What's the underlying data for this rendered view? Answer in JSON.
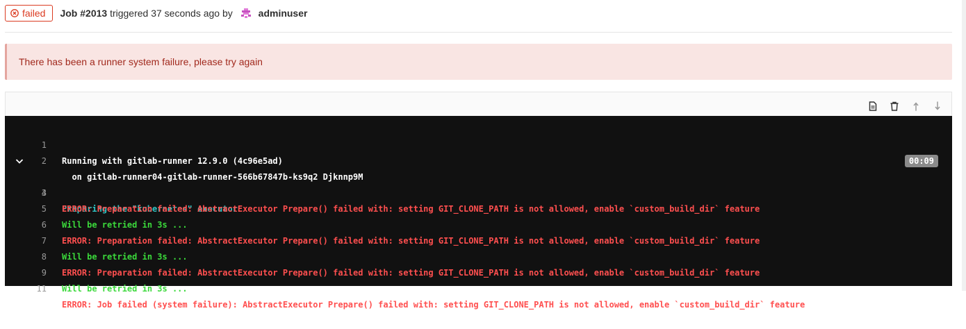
{
  "header": {
    "status_label": "failed",
    "job_label": "Job #2013",
    "triggered_text": " triggered 37 seconds ago by ",
    "user_name": "adminuser"
  },
  "alert": {
    "message": "There has been a runner system failure, please try again"
  },
  "log": {
    "section_duration": "00:09",
    "lines": [
      {
        "n": "1",
        "text": "Running with gitlab-runner 12.9.0 (4c96e5ad)"
      },
      {
        "n": "2",
        "text": "  on gitlab-runner04-gitlab-runner-566b67847b-ks9q2 Djknnp9M"
      },
      {
        "n": "3",
        "text": "Preparing the \"kubernetes\" executor"
      },
      {
        "n": "4",
        "text": "ERROR: Preparation failed: AbstractExecutor Prepare() failed with: setting GIT_CLONE_PATH is not allowed, enable `custom_build_dir` feature"
      },
      {
        "n": "5",
        "text": "Will be retried in 3s ..."
      },
      {
        "n": "6",
        "text": "ERROR: Preparation failed: AbstractExecutor Prepare() failed with: setting GIT_CLONE_PATH is not allowed, enable `custom_build_dir` feature"
      },
      {
        "n": "7",
        "text": "Will be retried in 3s ..."
      },
      {
        "n": "8",
        "text": "ERROR: Preparation failed: AbstractExecutor Prepare() failed with: setting GIT_CLONE_PATH is not allowed, enable `custom_build_dir` feature"
      },
      {
        "n": "9",
        "text": "Will be retried in 3s ..."
      },
      {
        "n": "11",
        "text": "ERROR: Job failed (system failure): AbstractExecutor Prepare() failed with: setting GIT_CLONE_PATH is not allowed, enable `custom_build_dir` feature"
      }
    ]
  },
  "toolbar": {
    "icons": [
      "raw-log-icon",
      "erase-log-icon",
      "scroll-top-icon",
      "scroll-bottom-icon"
    ]
  },
  "colors": {
    "failed": "#db3b21",
    "alert_bg": "#f9e5e3",
    "alert_text": "#a1291d",
    "log_bg": "#111111",
    "log_error": "#ff4f4f",
    "log_success": "#3bd93b",
    "log_section": "#30c6c6"
  }
}
